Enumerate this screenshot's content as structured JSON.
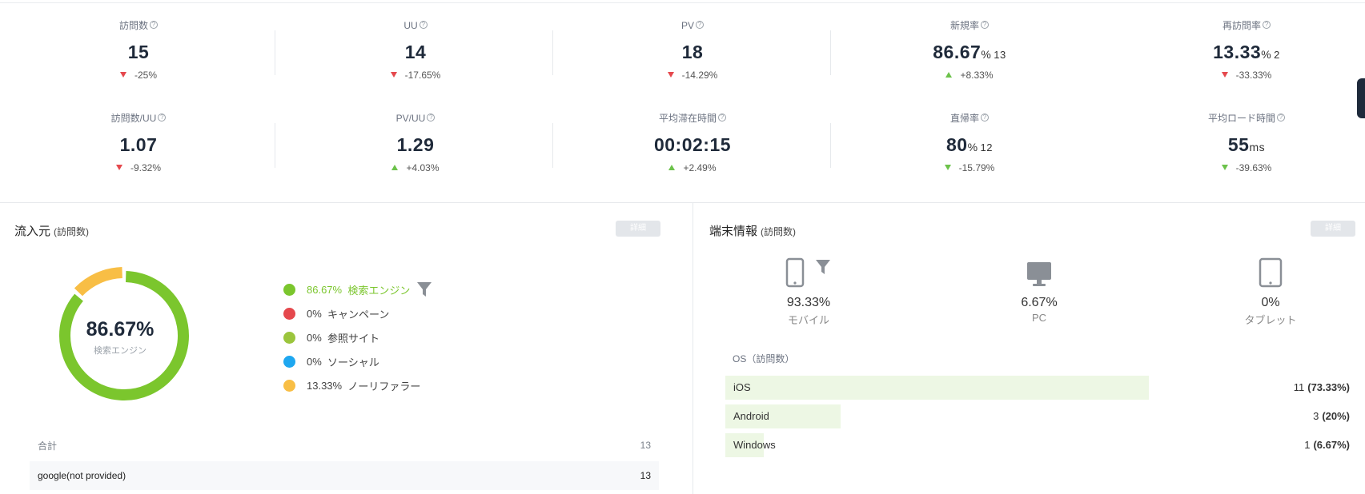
{
  "metrics": [
    {
      "label": "訪問数",
      "value": "15",
      "unit": "",
      "sub": "",
      "dir": "down",
      "delta": "-25%"
    },
    {
      "label": "UU",
      "value": "14",
      "unit": "",
      "sub": "",
      "dir": "down",
      "delta": "-17.65%"
    },
    {
      "label": "PV",
      "value": "18",
      "unit": "",
      "sub": "",
      "dir": "down",
      "delta": "-14.29%"
    },
    {
      "label": "新規率",
      "value": "86.67",
      "unit": "%",
      "sub": "13",
      "dir": "up",
      "delta": "+8.33%"
    },
    {
      "label": "再訪問率",
      "value": "13.33",
      "unit": "%",
      "sub": "2",
      "dir": "down",
      "delta": "-33.33%"
    },
    {
      "label": "訪問数/UU",
      "value": "1.07",
      "unit": "",
      "sub": "",
      "dir": "down",
      "delta": "-9.32%"
    },
    {
      "label": "PV/UU",
      "value": "1.29",
      "unit": "",
      "sub": "",
      "dir": "up",
      "delta": "+4.03%"
    },
    {
      "label": "平均滞在時間",
      "value": "00:02:15",
      "unit": "",
      "sub": "",
      "dir": "up",
      "delta": "+2.49%"
    },
    {
      "label": "直帰率",
      "value": "80",
      "unit": "%",
      "sub": "12",
      "dir": "down",
      "delta": "-15.79%"
    },
    {
      "label": "平均ロード時間",
      "value": "55",
      "unit": "ms",
      "sub": "",
      "dir": "down",
      "delta": "-39.63%"
    }
  ],
  "colors": {
    "up": "#6cc24a",
    "down": "#e5484d",
    "accent": "#7bc62d"
  },
  "traffic": {
    "title": "流入元",
    "title_small": "(訪問数)",
    "detail_label": "詳細",
    "donut": {
      "value": "86.67%",
      "label": "検索エンジン"
    },
    "sources": [
      {
        "pct": "86.67%",
        "name": "検索エンジン",
        "fraction": 0.8667,
        "color": "#7bc62d"
      },
      {
        "pct": "0%",
        "name": "キャンペーン",
        "fraction": 0,
        "color": "#e5484d"
      },
      {
        "pct": "0%",
        "name": "参照サイト",
        "fraction": 0,
        "color": "#9bc53d"
      },
      {
        "pct": "0%",
        "name": "ソーシャル",
        "fraction": 0,
        "color": "#1ea7f0"
      },
      {
        "pct": "13.33%",
        "name": "ノーリファラー",
        "fraction": 0.1333,
        "color": "#f8be45"
      }
    ],
    "table": {
      "total_label": "合計",
      "total_value": "13",
      "rows": [
        {
          "name": "google(not provided)",
          "value": "13"
        }
      ]
    }
  },
  "device": {
    "title": "端末情報",
    "title_small": "(訪問数)",
    "detail_label": "詳細",
    "items": [
      {
        "icon": "mobile-icon",
        "pct": "93.33%",
        "name": "モバイル"
      },
      {
        "icon": "pc-icon",
        "pct": "6.67%",
        "name": "PC"
      },
      {
        "icon": "tablet-icon",
        "pct": "0%",
        "name": "タブレット"
      }
    ],
    "os_title": "OS（訪問数）",
    "os": [
      {
        "name": "iOS",
        "count": "11",
        "pct": "(73.33%)",
        "fraction": 0.7333
      },
      {
        "name": "Android",
        "count": "3",
        "pct": "(20%)",
        "fraction": 0.2
      },
      {
        "name": "Windows",
        "count": "1",
        "pct": "(6.67%)",
        "fraction": 0.0667
      }
    ]
  }
}
